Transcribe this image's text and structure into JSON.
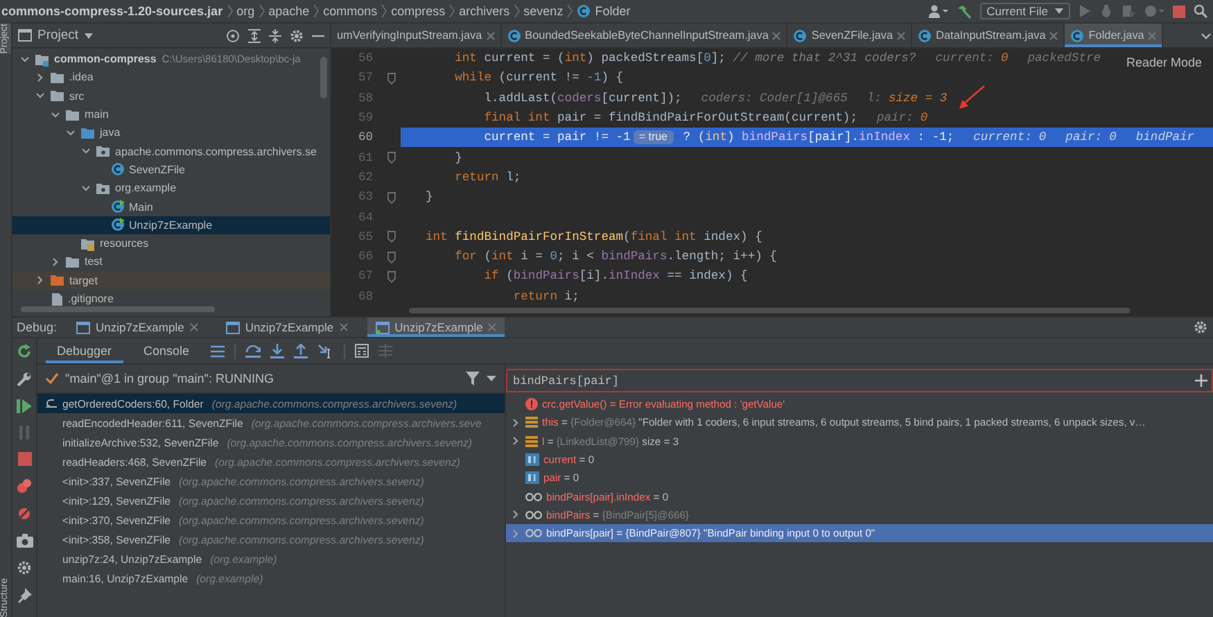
{
  "navbar": {
    "breadcrumbs": [
      "commons-compress-1.20-sources.jar",
      "org",
      "apache",
      "commons",
      "compress",
      "archivers",
      "sevenz",
      "Folder"
    ],
    "run_config": "Current File"
  },
  "side_strip": {
    "top_label": "Project",
    "bottom_label": "Structure"
  },
  "project": {
    "title": "Project",
    "tree": [
      {
        "label": "common-compress",
        "path": "C:\\Users\\86180\\Desktop\\bc-ja",
        "kind": "module",
        "expanded": true,
        "selected": false,
        "children": [
          {
            "label": ".idea",
            "kind": "folder",
            "expanded": false,
            "selected": false
          },
          {
            "label": "src",
            "kind": "folder",
            "expanded": true,
            "selected": false,
            "children": [
              {
                "label": "main",
                "kind": "folder",
                "expanded": true,
                "selected": false,
                "children": [
                  {
                    "label": "java",
                    "kind": "source",
                    "expanded": true,
                    "selected": false,
                    "children": [
                      {
                        "label": "apache.commons.compress.archivers.se",
                        "kind": "package",
                        "expanded": true,
                        "selected": false,
                        "children": [
                          {
                            "label": "SevenZFile",
                            "kind": "class",
                            "selected": false
                          }
                        ]
                      },
                      {
                        "label": "org.example",
                        "kind": "package",
                        "expanded": true,
                        "selected": false,
                        "children": [
                          {
                            "label": "Main",
                            "kind": "runnable",
                            "selected": false
                          },
                          {
                            "label": "Unzip7zExample",
                            "kind": "runnable",
                            "selected": true
                          }
                        ]
                      }
                    ]
                  },
                  {
                    "label": "resources",
                    "kind": "resources",
                    "selected": false
                  }
                ]
              },
              {
                "label": "test",
                "kind": "folder",
                "expanded": false,
                "selected": false
              }
            ]
          },
          {
            "label": "target",
            "kind": "excluded",
            "expanded": false,
            "selected": false
          },
          {
            "label": ".gitignore",
            "kind": "file",
            "selected": false
          }
        ]
      }
    ]
  },
  "editor": {
    "tabs": [
      {
        "label": "umVerifyingInputStream.java",
        "kind": "file",
        "selected": false
      },
      {
        "label": "BoundedSeekableByteChannelInputStream.java",
        "kind": "class",
        "selected": false
      },
      {
        "label": "SevenZFile.java",
        "kind": "class",
        "selected": false
      },
      {
        "label": "DataInputStream.java",
        "kind": "class",
        "selected": false
      },
      {
        "label": "Folder.java",
        "kind": "class",
        "selected": true
      }
    ],
    "reader_mode": "Reader Mode",
    "lines": [
      {
        "number": "56",
        "fold": false,
        "selected": false,
        "tokens": [
          {
            "kind": "kw",
            "text": "    int"
          },
          {
            "kind": "plain",
            "text": " current = ("
          },
          {
            "kind": "kw",
            "text": "int"
          },
          {
            "kind": "plain",
            "text": ") packedStreams["
          },
          {
            "kind": "num",
            "text": "0"
          },
          {
            "kind": "plain",
            "text": "]; "
          },
          {
            "kind": "comment",
            "text": "// more that 2^31 coders?"
          }
        ],
        "hints": [
          {
            "label": "current:",
            "value": "0"
          },
          {
            "label": "packedStre"
          }
        ]
      },
      {
        "number": "57",
        "fold": true,
        "selected": false,
        "tokens": [
          {
            "kind": "kw",
            "text": "    while"
          },
          {
            "kind": "plain",
            "text": " (current != "
          },
          {
            "kind": "num",
            "text": "-1"
          },
          {
            "kind": "plain",
            "text": ") {"
          }
        ]
      },
      {
        "number": "58",
        "fold": false,
        "selected": false,
        "tokens": [
          {
            "kind": "plain",
            "text": "        l.addLast("
          },
          {
            "kind": "field",
            "text": "coders"
          },
          {
            "kind": "plain",
            "text": "[current]);"
          }
        ],
        "hints": [
          {
            "label": "coders: Coder[1]@665"
          },
          {
            "label": "l:",
            "value": "size = 3"
          }
        ]
      },
      {
        "number": "59",
        "fold": false,
        "selected": false,
        "tokens": [
          {
            "kind": "kw",
            "text": "        final int"
          },
          {
            "kind": "plain",
            "text": " pair = findBindPairForOutStream(current);"
          }
        ],
        "hints": [
          {
            "label": "pair:",
            "value": "0"
          }
        ]
      },
      {
        "number": "60",
        "fold": false,
        "selected": true,
        "tokens": [
          {
            "kind": "plain",
            "text": "        current = pair != "
          },
          {
            "kind": "num",
            "text": "-1"
          },
          {
            "kind": "chip",
            "text": "= true"
          },
          {
            "kind": "plain",
            "text": " ? ("
          },
          {
            "kind": "kw",
            "text": "int"
          },
          {
            "kind": "plain",
            "text": ") "
          },
          {
            "kind": "field",
            "text": "bindPairs"
          },
          {
            "kind": "plain",
            "text": "[pair]."
          },
          {
            "kind": "field",
            "text": "inIndex"
          },
          {
            "kind": "plain",
            "text": " : "
          },
          {
            "kind": "num",
            "text": "-1"
          },
          {
            "kind": "plain",
            "text": ";"
          }
        ],
        "hints": [
          {
            "label": "current:",
            "value": "0"
          },
          {
            "label": "pair:",
            "value": "0"
          },
          {
            "label": "bindPair"
          }
        ]
      },
      {
        "number": "61",
        "fold": true,
        "selected": false,
        "tokens": [
          {
            "kind": "plain",
            "text": "    }"
          }
        ]
      },
      {
        "number": "62",
        "fold": false,
        "selected": false,
        "tokens": [
          {
            "kind": "kw",
            "text": "    return"
          },
          {
            "kind": "plain",
            "text": " l;"
          }
        ]
      },
      {
        "number": "63",
        "fold": true,
        "selected": false,
        "tokens": [
          {
            "kind": "plain",
            "text": "}"
          }
        ]
      },
      {
        "number": "64",
        "fold": false,
        "selected": false
      },
      {
        "number": "65",
        "fold": true,
        "selected": false,
        "tokens": [
          {
            "kind": "kw",
            "text": "int"
          },
          {
            "kind": "method",
            "text": " findBindPairForInStream"
          },
          {
            "kind": "plain",
            "text": "("
          },
          {
            "kind": "kw",
            "text": "final int"
          },
          {
            "kind": "plain",
            "text": " index) {"
          }
        ]
      },
      {
        "number": "66",
        "fold": true,
        "selected": false,
        "tokens": [
          {
            "kind": "kw",
            "text": "    for"
          },
          {
            "kind": "plain",
            "text": " ("
          },
          {
            "kind": "kw",
            "text": "int"
          },
          {
            "kind": "plain",
            "text": " i = "
          },
          {
            "kind": "num",
            "text": "0"
          },
          {
            "kind": "plain",
            "text": "; i < "
          },
          {
            "kind": "field",
            "text": "bindPairs"
          },
          {
            "kind": "plain",
            "text": ".length; i++) {"
          }
        ]
      },
      {
        "number": "67",
        "fold": true,
        "selected": false,
        "tokens": [
          {
            "kind": "kw",
            "text": "        if"
          },
          {
            "kind": "plain",
            "text": " ("
          },
          {
            "kind": "field",
            "text": "bindPairs"
          },
          {
            "kind": "plain",
            "text": "[i]."
          },
          {
            "kind": "field",
            "text": "inIndex"
          },
          {
            "kind": "plain",
            "text": " == index) {"
          }
        ]
      },
      {
        "number": "68",
        "fold": false,
        "selected": false,
        "tokens": [
          {
            "kind": "kw",
            "text": "            return"
          },
          {
            "kind": "plain",
            "text": " i;"
          }
        ]
      }
    ]
  },
  "debug": {
    "title": "Debug:",
    "sessions": [
      {
        "label": "Unzip7zExample",
        "running": false,
        "selected": false
      },
      {
        "label": "Unzip7zExample",
        "running": false,
        "selected": false
      },
      {
        "label": "Unzip7zExample",
        "running": true,
        "selected": true
      }
    ],
    "subtabs": [
      {
        "label": "Debugger",
        "selected": true
      },
      {
        "label": "Console",
        "selected": false
      }
    ],
    "thread": "\"main\"@1 in group \"main\": RUNNING",
    "frames": [
      {
        "method": "getOrderedCoders:60, Folder",
        "package": "(org.apache.commons.compress.archivers.sevenz)",
        "selected": true
      },
      {
        "method": "readEncodedHeader:611, SevenZFile",
        "package": "(org.apache.commons.compress.archivers.seve",
        "selected": false
      },
      {
        "method": "initializeArchive:532, SevenZFile",
        "package": "(org.apache.commons.compress.archivers.sevenz)",
        "selected": false
      },
      {
        "method": "readHeaders:468, SevenZFile",
        "package": "(org.apache.commons.compress.archivers.sevenz)",
        "selected": false
      },
      {
        "method": "<init>:337, SevenZFile",
        "package": "(org.apache.commons.compress.archivers.sevenz)",
        "selected": false
      },
      {
        "method": "<init>:129, SevenZFile",
        "package": "(org.apache.commons.compress.archivers.sevenz)",
        "selected": false
      },
      {
        "method": "<init>:370, SevenZFile",
        "package": "(org.apache.commons.compress.archivers.sevenz)",
        "selected": false
      },
      {
        "method": "<init>:358, SevenZFile",
        "package": "(org.apache.commons.compress.archivers.sevenz)",
        "selected": false
      },
      {
        "method": "unzip7z:24, Unzip7zExample",
        "package": "(org.example)",
        "selected": false
      },
      {
        "method": "main:16, Unzip7zExample",
        "package": "(org.example)",
        "selected": false
      }
    ],
    "watch_input": "bindPairs[pair]",
    "variables": [
      {
        "kind": "error",
        "name": "crc.getValue()",
        "operator": "=",
        "value": "Error evaluating method : 'getValue'",
        "selected": false
      },
      {
        "kind": "object",
        "name": "this",
        "operator": "=",
        "ref": "{Folder@664}",
        "value": "\"Folder with 1 coders, 6 input streams, 6 output streams, 5 bind pairs, 1 packed streams, 6 unpack sizes, v…",
        "expanded": false,
        "selected": false
      },
      {
        "kind": "object",
        "name": "l",
        "operator": "=",
        "ref": "{LinkedList@799}",
        "value": "size = 3",
        "expanded": false,
        "selected": false
      },
      {
        "kind": "primitive",
        "name": "current",
        "operator": "=",
        "value": "0",
        "selected": false
      },
      {
        "kind": "primitive",
        "name": "pair",
        "operator": "=",
        "value": "0",
        "selected": false
      },
      {
        "kind": "watch",
        "name": "bindPairs[pair].inIndex",
        "operator": "=",
        "value": "0",
        "selected": false
      },
      {
        "kind": "watch",
        "name": "bindPairs",
        "operator": "=",
        "ref": "{BindPair[5]@666}",
        "expanded": false,
        "selected": false
      },
      {
        "kind": "watch",
        "name": "bindPairs[pair]",
        "operator": "=",
        "ref": "{BindPair@807}",
        "value": "\"BindPair binding input 0 to output 0\"",
        "expanded": false,
        "selected": true
      }
    ]
  }
}
